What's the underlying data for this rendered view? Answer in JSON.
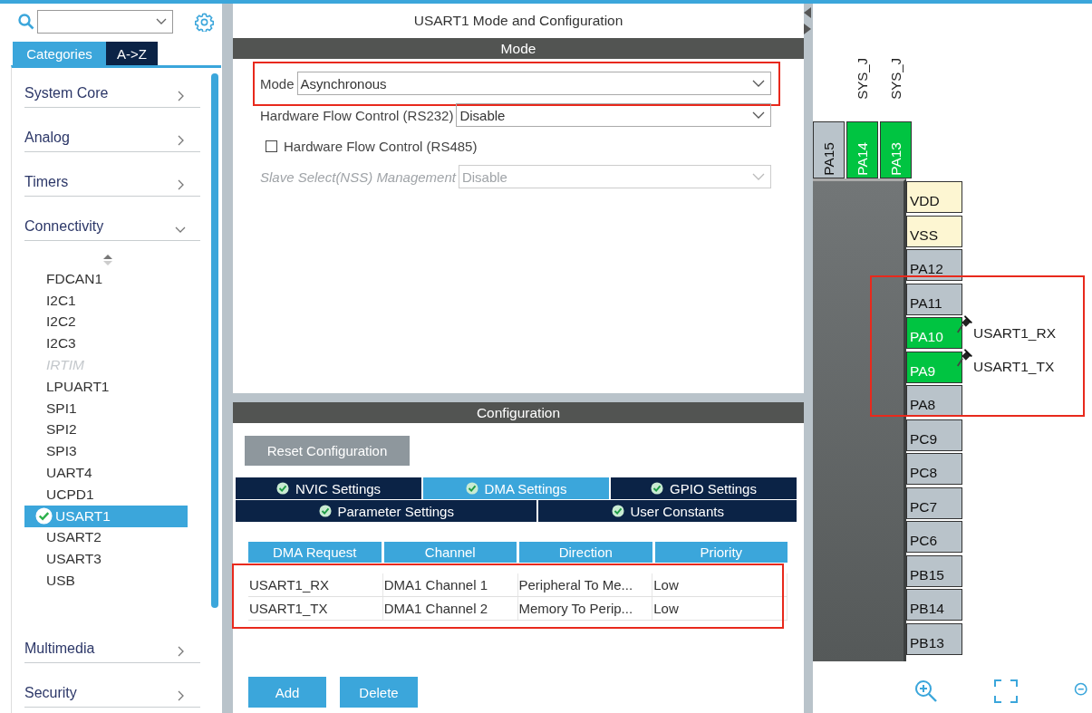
{
  "category_tabs": [
    {
      "label": "Categories",
      "selected": true
    },
    {
      "label": "A->Z",
      "selected": false
    }
  ],
  "categories": [
    {
      "label": "System Core",
      "expanded": false
    },
    {
      "label": "Analog",
      "expanded": false
    },
    {
      "label": "Timers",
      "expanded": false
    },
    {
      "label": "Connectivity",
      "expanded": true,
      "children": [
        {
          "label": "FDCAN1",
          "disabled": false,
          "selected": false,
          "configured": false
        },
        {
          "label": "I2C1",
          "disabled": false,
          "selected": false,
          "configured": false
        },
        {
          "label": "I2C2",
          "disabled": false,
          "selected": false,
          "configured": false
        },
        {
          "label": "I2C3",
          "disabled": false,
          "selected": false,
          "configured": false
        },
        {
          "label": "IRTIM",
          "disabled": true,
          "selected": false,
          "configured": false
        },
        {
          "label": "LPUART1",
          "disabled": false,
          "selected": false,
          "configured": false
        },
        {
          "label": "SPI1",
          "disabled": false,
          "selected": false,
          "configured": false
        },
        {
          "label": "SPI2",
          "disabled": false,
          "selected": false,
          "configured": false
        },
        {
          "label": "SPI3",
          "disabled": false,
          "selected": false,
          "configured": false
        },
        {
          "label": "UART4",
          "disabled": false,
          "selected": false,
          "configured": false
        },
        {
          "label": "UCPD1",
          "disabled": false,
          "selected": false,
          "configured": false
        },
        {
          "label": "USART1",
          "disabled": false,
          "selected": true,
          "configured": true
        },
        {
          "label": "USART2",
          "disabled": false,
          "selected": false,
          "configured": false
        },
        {
          "label": "USART3",
          "disabled": false,
          "selected": false,
          "configured": false
        },
        {
          "label": "USB",
          "disabled": false,
          "selected": false,
          "configured": false
        }
      ]
    },
    {
      "label": "Multimedia",
      "expanded": false
    },
    {
      "label": "Security",
      "expanded": false
    }
  ],
  "panel_title": "USART1 Mode and Configuration",
  "mode_section": {
    "title": "Mode",
    "fields": [
      {
        "kind": "select",
        "label": "Mode",
        "value": "Asynchronous",
        "disabled": false,
        "highlighted": true
      },
      {
        "kind": "select",
        "label": "Hardware Flow Control (RS232)",
        "value": "Disable",
        "disabled": false
      },
      {
        "kind": "checkbox",
        "label": "Hardware Flow Control (RS485)",
        "checked": false
      },
      {
        "kind": "select",
        "label": "Slave Select(NSS) Management",
        "value": "Disable",
        "disabled": true
      }
    ]
  },
  "configuration_section": {
    "title": "Configuration",
    "reset_button": "Reset Configuration",
    "tab_rows": [
      [
        {
          "label": "NVIC Settings",
          "selected": false,
          "configured": true
        },
        {
          "label": "DMA Settings",
          "selected": true,
          "configured": true
        },
        {
          "label": "GPIO Settings",
          "selected": false,
          "configured": true
        }
      ],
      [
        {
          "label": "Parameter Settings",
          "selected": false,
          "configured": true
        },
        {
          "label": "User Constants",
          "selected": false,
          "configured": true
        }
      ]
    ],
    "table": {
      "highlighted": true,
      "columns": [
        "DMA Request",
        "Channel",
        "Direction",
        "Priority"
      ],
      "rows": [
        [
          "USART1_RX",
          "DMA1 Channel 1",
          "Peripheral To Me...",
          "Low"
        ],
        [
          "USART1_TX",
          "DMA1 Channel 2",
          "Memory To Perip...",
          "Low"
        ]
      ]
    },
    "buttons": [
      "Add",
      "Delete"
    ]
  },
  "pinout": {
    "highlighted": true,
    "top_pins": [
      {
        "name": "PA15",
        "assigned": false
      },
      {
        "name": "PA14",
        "assigned": true,
        "signal": "SYS_J"
      },
      {
        "name": "PA13",
        "assigned": true,
        "signal": "SYS_J"
      }
    ],
    "right_pins": [
      {
        "name": "VDD",
        "kind": "power"
      },
      {
        "name": "VSS",
        "kind": "power"
      },
      {
        "name": "PA12",
        "kind": "io",
        "assigned": false
      },
      {
        "name": "PA11",
        "kind": "io",
        "assigned": false
      },
      {
        "name": "PA10",
        "kind": "io",
        "assigned": true,
        "pinned": true,
        "signal": "USART1_RX"
      },
      {
        "name": "PA9",
        "kind": "io",
        "assigned": true,
        "pinned": true,
        "signal": "USART1_TX"
      },
      {
        "name": "PA8",
        "kind": "io",
        "assigned": false
      },
      {
        "name": "PC9",
        "kind": "io",
        "assigned": false
      },
      {
        "name": "PC8",
        "kind": "io",
        "assigned": false
      },
      {
        "name": "PC7",
        "kind": "io",
        "assigned": false
      },
      {
        "name": "PC6",
        "kind": "io",
        "assigned": false
      },
      {
        "name": "PB15",
        "kind": "io",
        "assigned": false
      },
      {
        "name": "PB14",
        "kind": "io",
        "assigned": false
      },
      {
        "name": "PB13",
        "kind": "io",
        "assigned": false
      }
    ]
  }
}
